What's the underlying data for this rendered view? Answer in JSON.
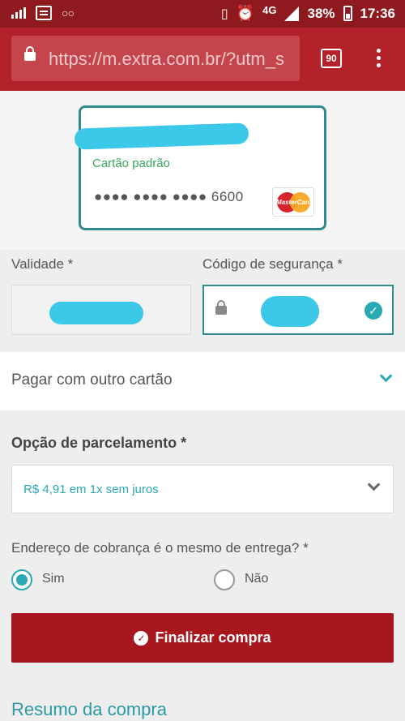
{
  "status_bar": {
    "network": "4G",
    "battery": "38%",
    "time": "17:36"
  },
  "browser": {
    "url": "https://m.extra.com.br/?utm_s",
    "tab_count": "90"
  },
  "card": {
    "label": "Cartão padrão",
    "number_masked": "●●●● ●●●● ●●●● 6600",
    "brand": "MasterCard"
  },
  "fields": {
    "validity_label": "Validade *",
    "cvv_label": "Código de segurança *"
  },
  "other_card": {
    "label": "Pagar com outro cartão"
  },
  "installments": {
    "title": "Opção de parcelamento *",
    "selected": "R$ 4,91 em 1x sem juros"
  },
  "billing": {
    "question": "Endereço de cobrança é o mesmo de entrega? *",
    "options": [
      "Sim",
      "Não"
    ],
    "selected": "Sim"
  },
  "actions": {
    "finish_label": "Finalizar compra"
  },
  "summary": {
    "title": "Resumo da compra"
  },
  "colors": {
    "status_bar": "#8e1a1f",
    "browser_bar": "#b3222b",
    "accent_teal": "#2aa8b4",
    "primary_button": "#a8161e"
  },
  "icons": [
    "signal-icon",
    "message-icon",
    "voicemail-icon",
    "vibrate-icon",
    "alarm-icon",
    "cell-signal-icon",
    "battery-icon",
    "lock-icon",
    "tabs-icon",
    "menu-icon",
    "mastercard-logo",
    "check-icon",
    "chevron-down-icon",
    "radio-icon"
  ]
}
